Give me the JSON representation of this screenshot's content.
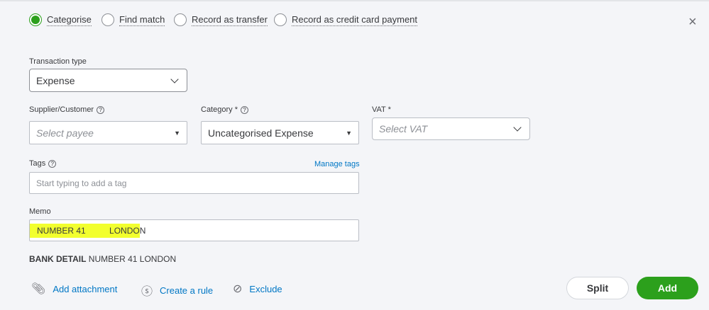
{
  "modes": [
    {
      "label": "Categorise",
      "selected": true
    },
    {
      "label": "Find match",
      "selected": false
    },
    {
      "label": "Record as transfer",
      "selected": false
    },
    {
      "label": "Record as credit card payment",
      "selected": false
    }
  ],
  "close_icon": "×",
  "transaction_type": {
    "label": "Transaction type",
    "value": "Expense"
  },
  "supplier": {
    "label": "Supplier/Customer",
    "placeholder": "Select payee"
  },
  "category": {
    "label": "Category *",
    "value": "Uncategorised Expense"
  },
  "vat": {
    "label": "VAT *",
    "placeholder": "Select VAT"
  },
  "tags": {
    "label": "Tags",
    "manage": "Manage tags",
    "placeholder": "Start typing to add a tag"
  },
  "memo": {
    "label": "Memo",
    "value_highlighted": "NUMBER 41          LONDO",
    "value_rest": "N"
  },
  "bank_detail": {
    "label": "BANK DETAIL",
    "value": "NUMBER 41 LONDON"
  },
  "actions": {
    "attachment": "Add attachment",
    "rule": "Create a rule",
    "exclude": "Exclude"
  },
  "buttons": {
    "split": "Split",
    "add": "Add"
  },
  "colors": {
    "accent": "#2ca01c",
    "link": "#0077c5",
    "highlight": "#f2ff2e"
  }
}
